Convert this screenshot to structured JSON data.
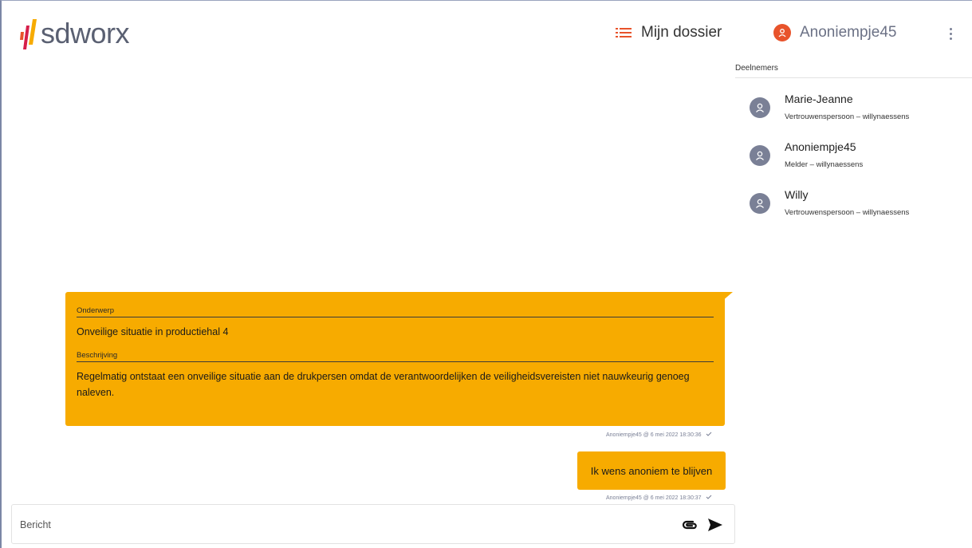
{
  "brand": {
    "logo_text": "sdworx",
    "accent_orange": "#e8532b",
    "message_color": "#f7ab00"
  },
  "header": {
    "dossier_label": "Mijn dossier",
    "dossier_icon": "list-icon",
    "user_label": "Anoniempje45",
    "user_icon": "user-icon",
    "menu_icon": "kebab-menu-icon"
  },
  "participants": {
    "title": "Deelnemers",
    "items": [
      {
        "name": "Marie-Jeanne",
        "role": "Vertrouwenspersoon – willynaessens"
      },
      {
        "name": "Anoniempje45",
        "role": "Melder – willynaessens"
      },
      {
        "name": "Willy",
        "role": "Vertrouwenspersoon – willynaessens"
      }
    ]
  },
  "messages": [
    {
      "subject_label": "Onderwerp",
      "subject": "Onveilige situatie in productiehal 4",
      "description_label": "Beschrijving",
      "description": "Regelmatig ontstaat een onveilige situatie aan de drukpersen omdat de verantwoordelijken de veiligheidsvereisten niet nauwkeurig genoeg naleven.",
      "meta": "Anoniempje45 @ 6 mei 2022 18:30:36"
    },
    {
      "text": "Ik wens anoniem te blijven",
      "meta": "Anoniempje45 @ 6 mei 2022 18:30:37"
    }
  ],
  "composer": {
    "placeholder": "Bericht",
    "attach_icon": "paperclip-icon",
    "send_icon": "send-icon"
  }
}
